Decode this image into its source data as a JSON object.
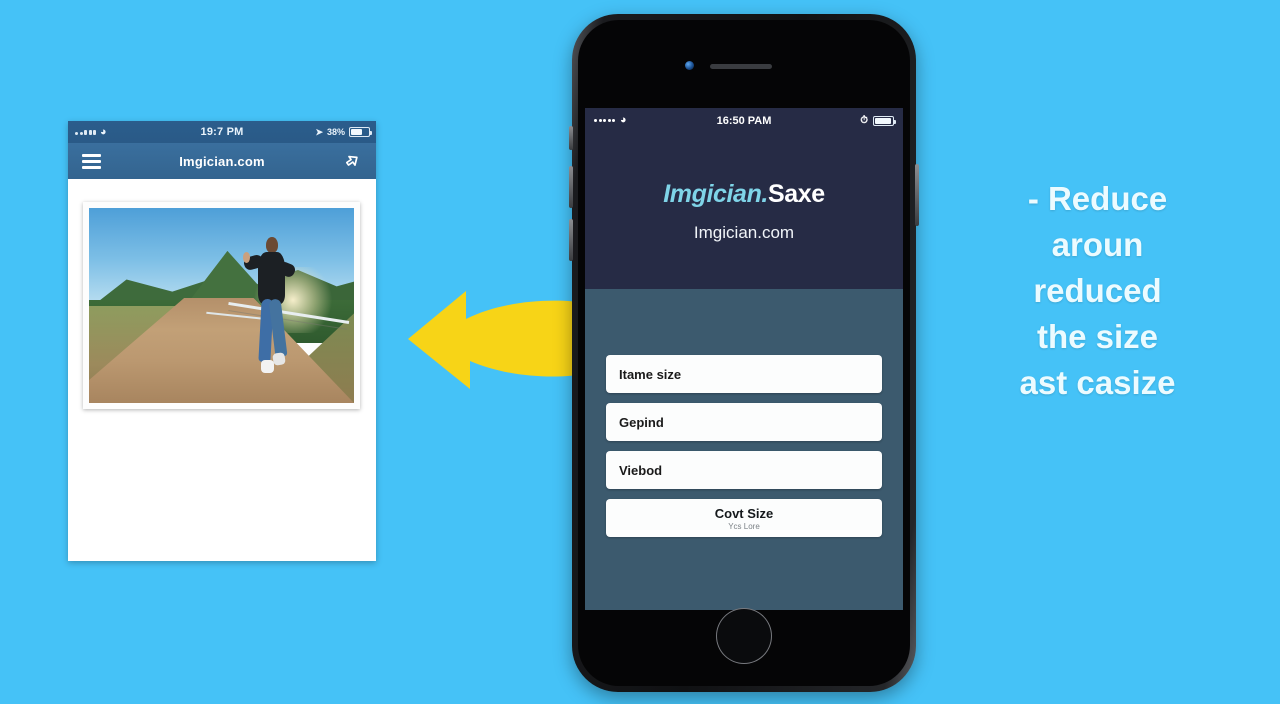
{
  "background_color": "#45c2f7",
  "left_phone": {
    "status_bar": {
      "signal_icon": "signal-dots-icon",
      "wifi_icon": "wifi-icon",
      "time": "19:7 PM",
      "location_icon": "location-arrow-icon",
      "battery_percent": "38%",
      "battery_icon": "battery-icon"
    },
    "nav_bar": {
      "menu_icon": "hamburger-menu-icon",
      "title": "Imgician.com",
      "share_icon": "share-icon"
    },
    "content": {
      "photo_alt": "man running on dirt road with mountains and guardrail"
    }
  },
  "arrow": {
    "icon": "double-headed-arrow-icon",
    "color": "#f7d417"
  },
  "right_phone": {
    "hardware": {
      "camera_icon": "front-camera-icon",
      "speaker_icon": "earpiece-speaker-icon",
      "home_button_icon": "home-button-icon",
      "power_button": "power-button",
      "volume_up_button": "volume-up-button",
      "volume_down_button": "volume-down-button",
      "mute_switch": "mute-switch"
    },
    "status_bar": {
      "signal_icon": "signal-dots-icon",
      "wifi_icon": "wifi-icon",
      "time": "16:50 PAM",
      "alarm_icon": "alarm-icon",
      "battery_icon": "battery-icon"
    },
    "header": {
      "brand_primary": "Imgician.",
      "brand_secondary": "Saxe",
      "brand_primary_color": "#7fd4e8",
      "brand_secondary_color": "#ffffff",
      "subtitle": "Imgician.com",
      "background_color": "#262b45"
    },
    "body": {
      "background_color": "#3c5a6e",
      "fields": [
        {
          "label": "Itame size"
        },
        {
          "label": "Gepind"
        },
        {
          "label": "Viebod"
        }
      ],
      "cta": {
        "label": "Covt Size",
        "sublabel": "Ycs Lore"
      }
    }
  },
  "caption": {
    "lines": [
      "- Reduce",
      "aroun",
      "reduced",
      "the size",
      "ast casize"
    ],
    "color": "#ecfbff"
  }
}
